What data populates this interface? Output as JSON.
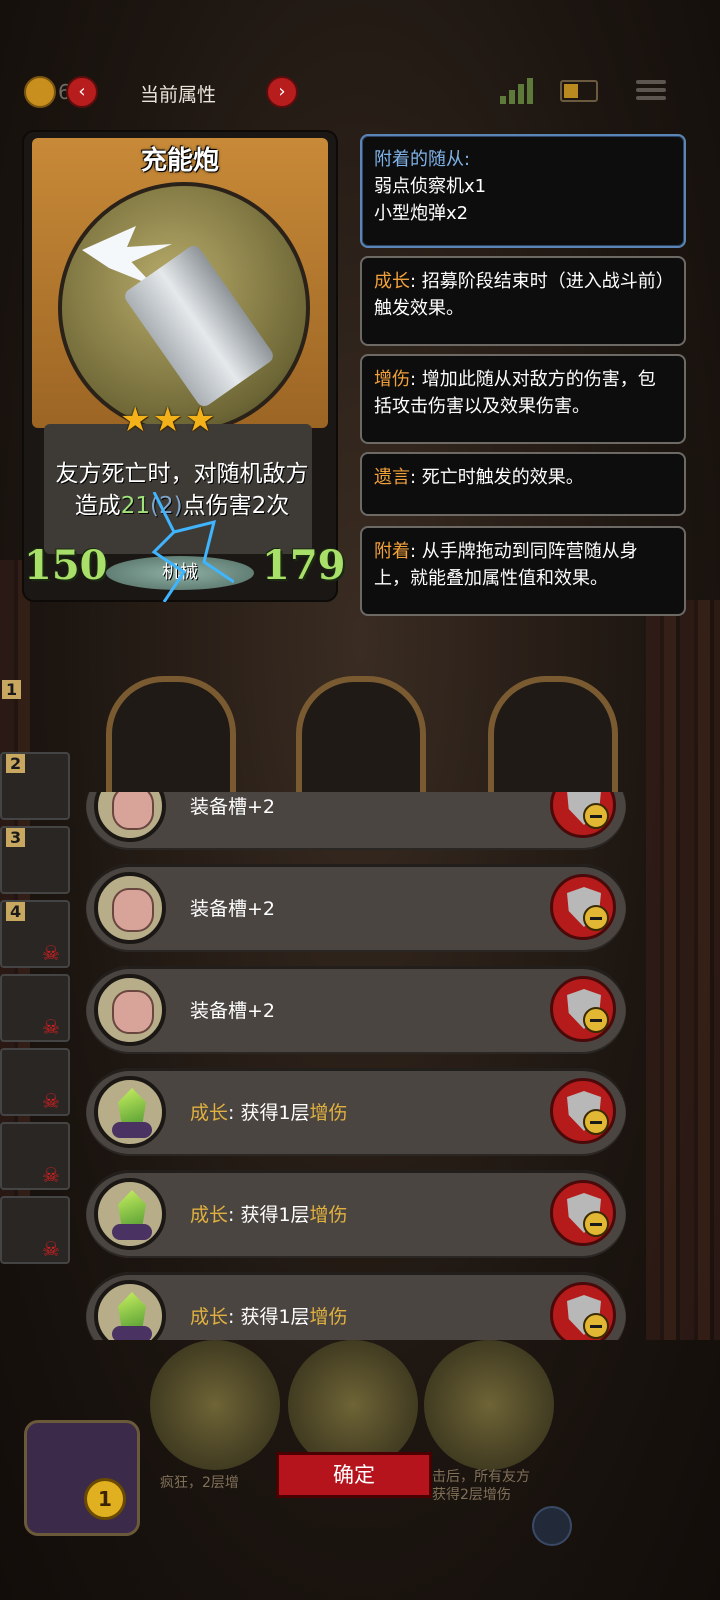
{
  "topbar": {
    "coin_value": "69",
    "title": "当前属性",
    "prev_icon": "chevron-left-icon",
    "next_icon": "chevron-right-icon"
  },
  "card": {
    "name": "充能炮",
    "stars": "★★★",
    "description_pre": "友方死亡时，对随机敌方造成",
    "damage": "21",
    "damage_extra": "(2)",
    "description_post": "点伤害2次",
    "attack": "150",
    "health": "179",
    "tribe": "机械"
  },
  "panels": {
    "attached": {
      "title": "附着的随从:",
      "line1": "弱点侦察机x1",
      "line2": "小型炮弹x2"
    },
    "growth": {
      "keyword": "成长",
      "text": ": 招募阶段结束时（进入战斗前）触发效果。"
    },
    "dmg_up": {
      "keyword": "增伤",
      "text": ": 增加此随从对敌方的伤害，包括攻击伤害以及效果伤害。"
    },
    "deathrattle": {
      "keyword": "遗言",
      "text": ": 死亡时触发的效果。"
    },
    "attach": {
      "keyword": "附着",
      "text": ": 从手牌拖动到同阵营随从身上，就能叠加属性值和效果。"
    }
  },
  "side_numbers": [
    "1",
    "2",
    "3",
    "4"
  ],
  "buffs": [
    {
      "type": "pig",
      "label": "装备槽+2"
    },
    {
      "type": "pig",
      "label": "装备槽+2"
    },
    {
      "type": "pig",
      "label": "装备槽+2"
    },
    {
      "type": "gem",
      "prefix": "成长",
      "mid": ": 获得1层",
      "suffix": "增伤"
    },
    {
      "type": "gem",
      "prefix": "成长",
      "mid": ": 获得1层",
      "suffix": "增伤"
    },
    {
      "type": "gem",
      "prefix": "成长",
      "mid": ": 获得1层",
      "suffix": "增伤"
    }
  ],
  "bottom": {
    "confirm_label": "确定",
    "left_text": "疯狂，2层增",
    "right_text_1": "击后，所有友方",
    "right_text_2": "获得2层增伤",
    "coin_count": "1"
  },
  "colors": {
    "accent_red": "#b5141c",
    "keyword_orange": "#f2a13a",
    "stat_green": "#a8e06a"
  }
}
